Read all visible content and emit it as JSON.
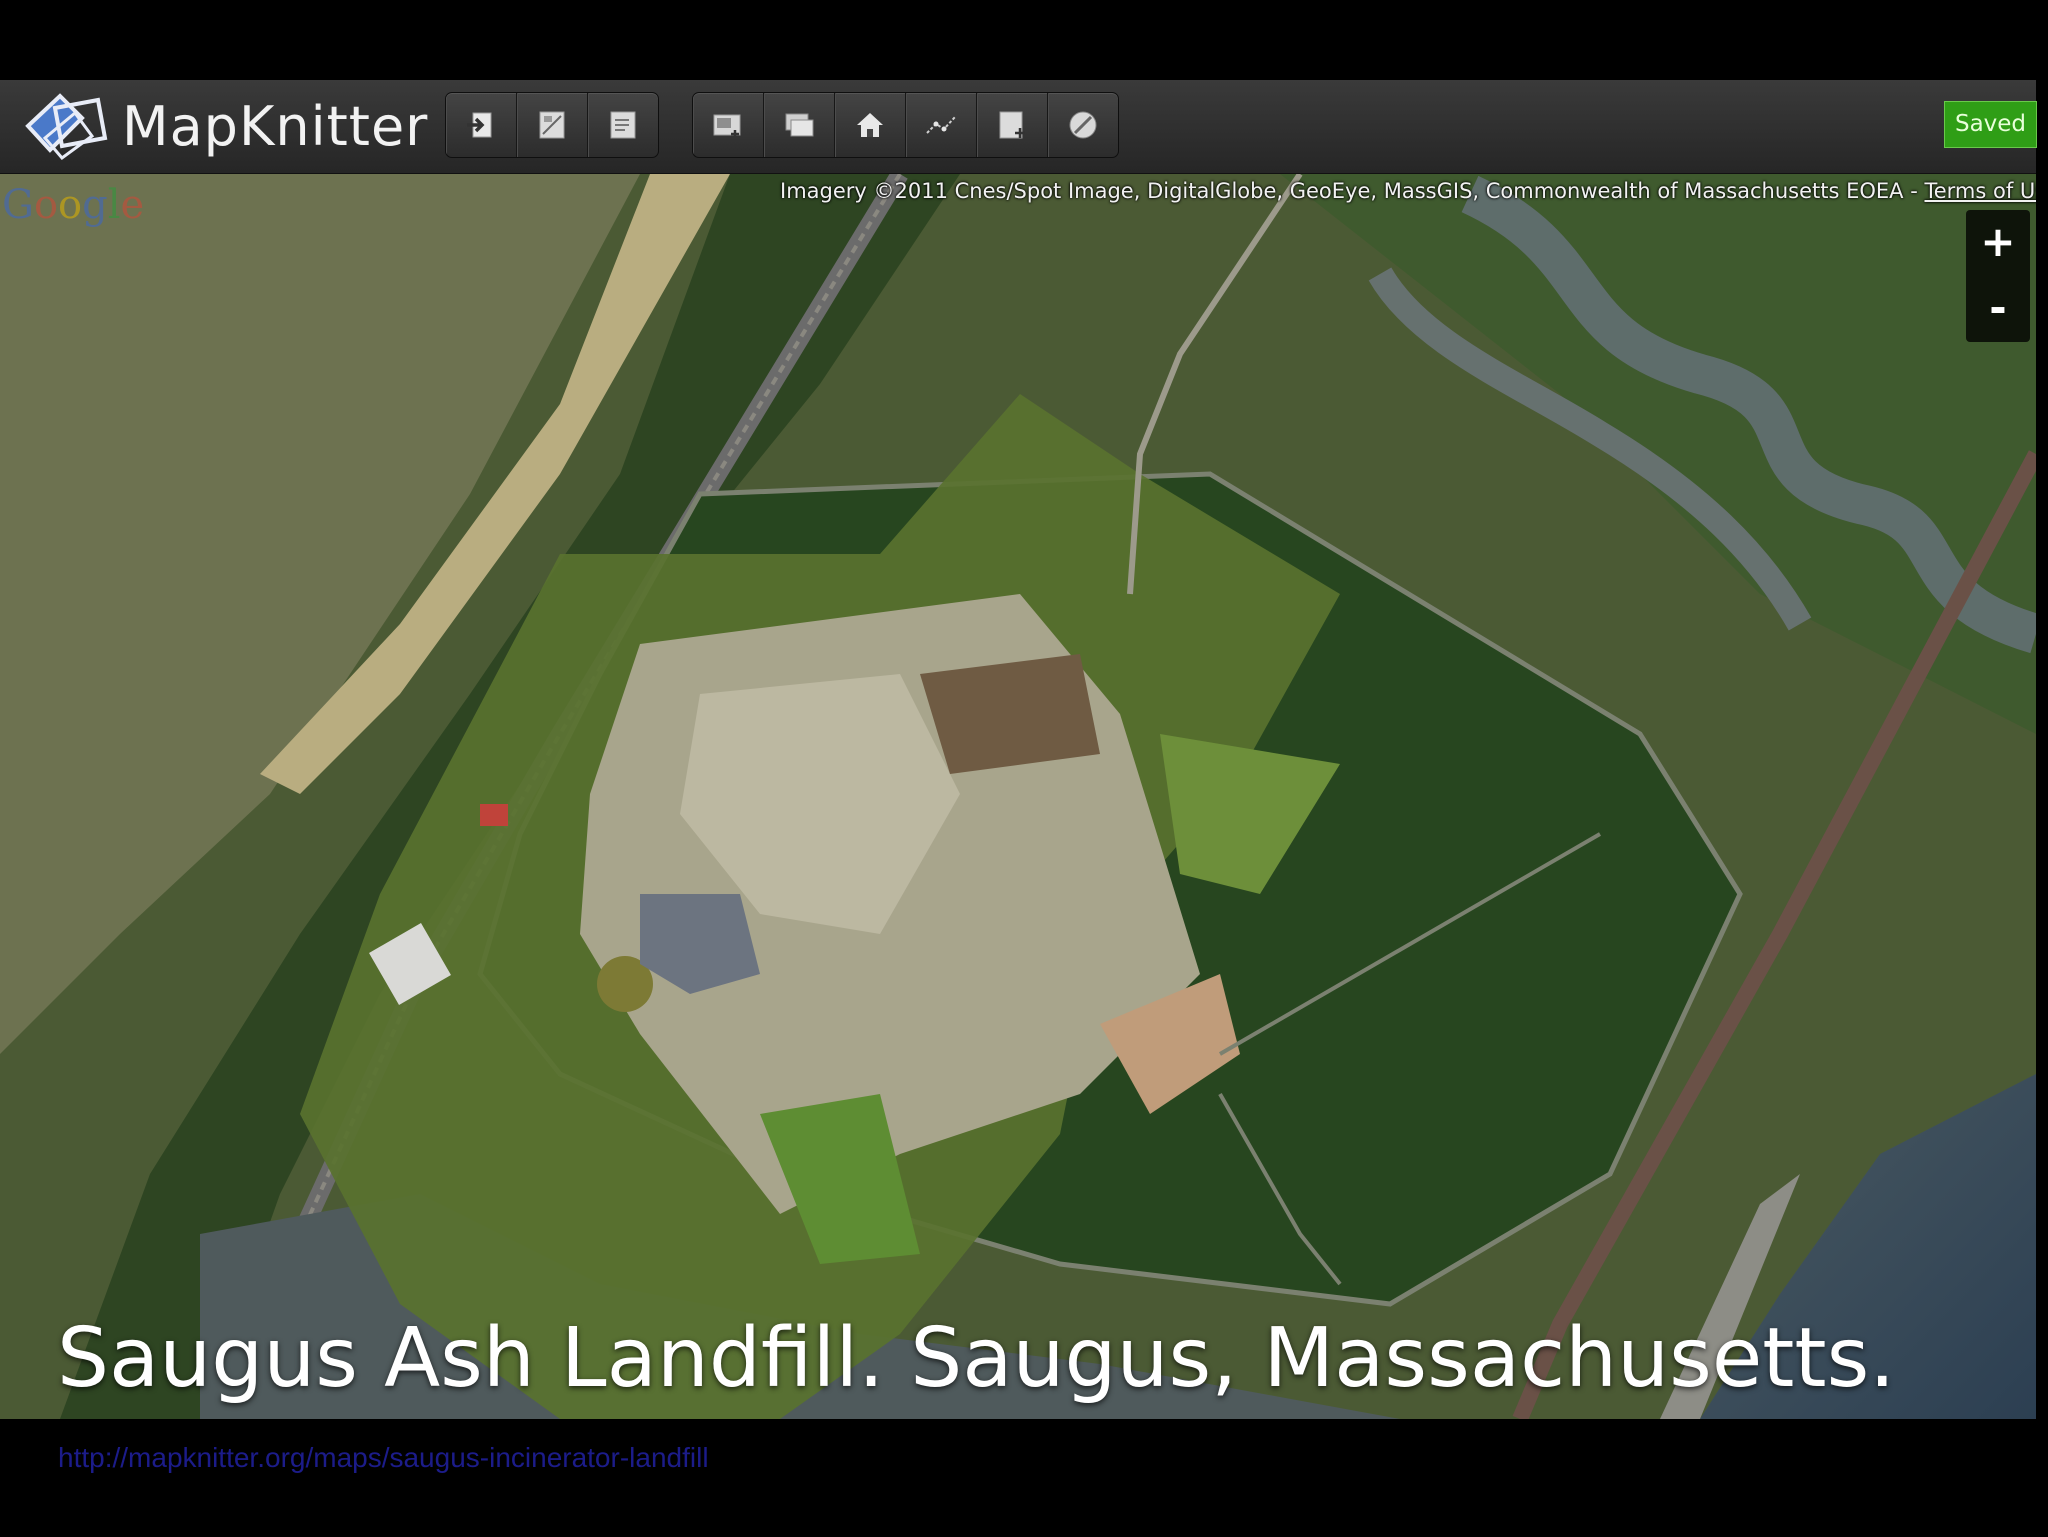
{
  "app": {
    "name": "MapKnitter",
    "status": "Saved"
  },
  "toolbar": {
    "group1": [
      {
        "icon": "import-icon"
      },
      {
        "icon": "image-edit-icon"
      },
      {
        "icon": "image-export-icon"
      }
    ],
    "group2": [
      {
        "icon": "add-image-icon"
      },
      {
        "icon": "layers-icon"
      },
      {
        "icon": "home-icon"
      },
      {
        "icon": "path-icon"
      },
      {
        "icon": "add-layer-icon"
      },
      {
        "icon": "circle-icon"
      }
    ]
  },
  "map": {
    "attribution_text": "Imagery ©2011 Cnes/Spot Image, DigitalGlobe, GeoEye, MassGIS, Commonwealth of Massachusetts EOEA - ",
    "terms_link": "Terms of Use",
    "provider_logo": "Google",
    "zoom_in": "+",
    "zoom_out": "-"
  },
  "caption": "Saugus Ash Landfill. Saugus, Massachusetts.",
  "source_url": "http://mapknitter.org/maps/saugus-incinerator-landfill",
  "colors": {
    "toolbar_bg": "#2f2f2f",
    "saved_green": "#2f9e16",
    "link_blue": "#1c1c8a"
  }
}
